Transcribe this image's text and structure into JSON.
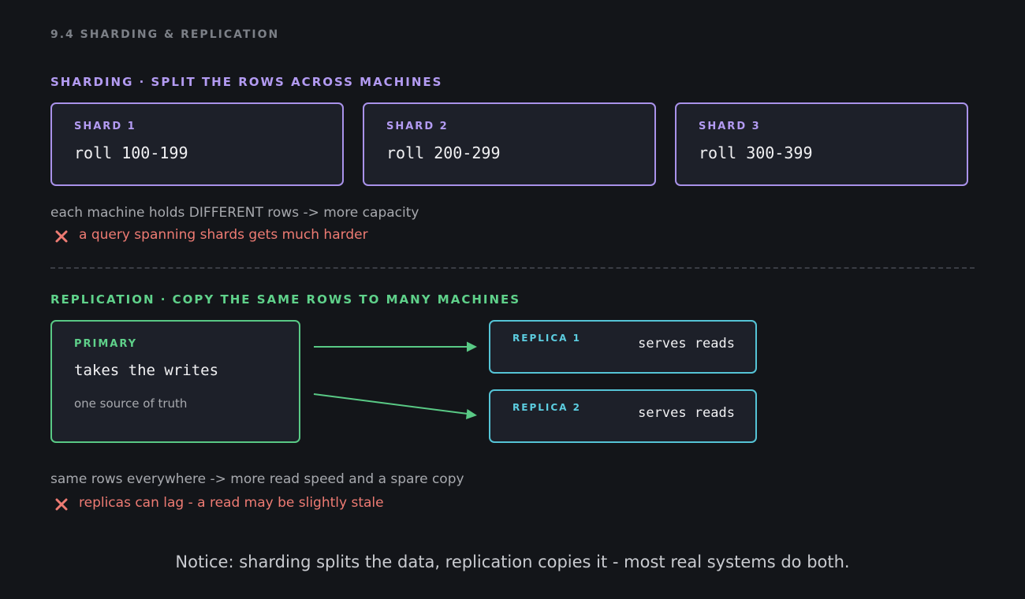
{
  "page_label": "9.4  SHARDING & REPLICATION",
  "sharding": {
    "heading": "SHARDING  ·  SPLIT THE ROWS ACROSS MACHINES",
    "shards": [
      {
        "title": "SHARD 1",
        "range": "roll 100-199"
      },
      {
        "title": "SHARD 2",
        "range": "roll 200-299"
      },
      {
        "title": "SHARD 3",
        "range": "roll 300-399"
      }
    ],
    "note": "each machine holds DIFFERENT rows  ->  more capacity",
    "con": "a query spanning shards gets much harder"
  },
  "replication": {
    "heading": "REPLICATION  ·  COPY THE SAME ROWS TO MANY MACHINES",
    "primary": {
      "title": "PRIMARY",
      "role": "takes the writes",
      "subtitle": "one source of truth"
    },
    "replicas": [
      {
        "title": "REPLICA 1",
        "role": "serves reads"
      },
      {
        "title": "REPLICA 2",
        "role": "serves reads"
      }
    ],
    "note": "same rows everywhere  ->  more read speed and a spare copy",
    "con": "replicas can lag - a read may be slightly stale"
  },
  "footer": "Notice: sharding splits the data, replication copies it - most real systems do both.",
  "colors": {
    "background": "#131519",
    "sharding_accent": "#b39bf2",
    "replication_accent": "#5fd18a",
    "replica_accent": "#5ccde0",
    "con_red": "#ee7b73",
    "muted_text": "#a7a9ae"
  },
  "icons": {
    "con_marker": "x-mark-icon",
    "connector": "arrow-right-icon"
  }
}
